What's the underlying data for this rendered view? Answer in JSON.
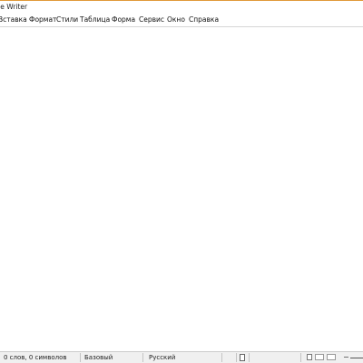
{
  "window": {
    "title": "ice Writer"
  },
  "menubar": {
    "items": [
      {
        "label": "Вставка"
      },
      {
        "label": "Формат"
      },
      {
        "label": "Стили"
      },
      {
        "label": "Таблица"
      },
      {
        "label": "Форма"
      },
      {
        "label": "Сервис"
      },
      {
        "label": "Окно"
      },
      {
        "label": "Справка"
      }
    ]
  },
  "statusbar": {
    "word_count": "0 слов, 0 символов",
    "page_style": "Базовый",
    "language": "Русский",
    "zoom_out_symbol": "−"
  },
  "colors": {
    "title_accent": "#e09a3a"
  }
}
